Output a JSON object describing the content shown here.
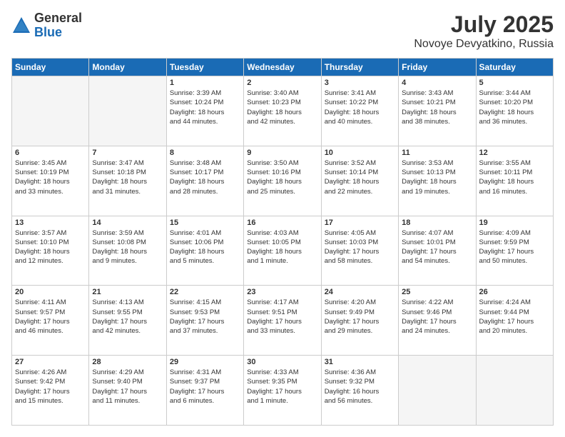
{
  "logo": {
    "general": "General",
    "blue": "Blue"
  },
  "header": {
    "month": "July 2025",
    "location": "Novoye Devyatkino, Russia"
  },
  "weekdays": [
    "Sunday",
    "Monday",
    "Tuesday",
    "Wednesday",
    "Thursday",
    "Friday",
    "Saturday"
  ],
  "weeks": [
    [
      {
        "day": "",
        "info": ""
      },
      {
        "day": "",
        "info": ""
      },
      {
        "day": "1",
        "info": "Sunrise: 3:39 AM\nSunset: 10:24 PM\nDaylight: 18 hours\nand 44 minutes."
      },
      {
        "day": "2",
        "info": "Sunrise: 3:40 AM\nSunset: 10:23 PM\nDaylight: 18 hours\nand 42 minutes."
      },
      {
        "day": "3",
        "info": "Sunrise: 3:41 AM\nSunset: 10:22 PM\nDaylight: 18 hours\nand 40 minutes."
      },
      {
        "day": "4",
        "info": "Sunrise: 3:43 AM\nSunset: 10:21 PM\nDaylight: 18 hours\nand 38 minutes."
      },
      {
        "day": "5",
        "info": "Sunrise: 3:44 AM\nSunset: 10:20 PM\nDaylight: 18 hours\nand 36 minutes."
      }
    ],
    [
      {
        "day": "6",
        "info": "Sunrise: 3:45 AM\nSunset: 10:19 PM\nDaylight: 18 hours\nand 33 minutes."
      },
      {
        "day": "7",
        "info": "Sunrise: 3:47 AM\nSunset: 10:18 PM\nDaylight: 18 hours\nand 31 minutes."
      },
      {
        "day": "8",
        "info": "Sunrise: 3:48 AM\nSunset: 10:17 PM\nDaylight: 18 hours\nand 28 minutes."
      },
      {
        "day": "9",
        "info": "Sunrise: 3:50 AM\nSunset: 10:16 PM\nDaylight: 18 hours\nand 25 minutes."
      },
      {
        "day": "10",
        "info": "Sunrise: 3:52 AM\nSunset: 10:14 PM\nDaylight: 18 hours\nand 22 minutes."
      },
      {
        "day": "11",
        "info": "Sunrise: 3:53 AM\nSunset: 10:13 PM\nDaylight: 18 hours\nand 19 minutes."
      },
      {
        "day": "12",
        "info": "Sunrise: 3:55 AM\nSunset: 10:11 PM\nDaylight: 18 hours\nand 16 minutes."
      }
    ],
    [
      {
        "day": "13",
        "info": "Sunrise: 3:57 AM\nSunset: 10:10 PM\nDaylight: 18 hours\nand 12 minutes."
      },
      {
        "day": "14",
        "info": "Sunrise: 3:59 AM\nSunset: 10:08 PM\nDaylight: 18 hours\nand 9 minutes."
      },
      {
        "day": "15",
        "info": "Sunrise: 4:01 AM\nSunset: 10:06 PM\nDaylight: 18 hours\nand 5 minutes."
      },
      {
        "day": "16",
        "info": "Sunrise: 4:03 AM\nSunset: 10:05 PM\nDaylight: 18 hours\nand 1 minute."
      },
      {
        "day": "17",
        "info": "Sunrise: 4:05 AM\nSunset: 10:03 PM\nDaylight: 17 hours\nand 58 minutes."
      },
      {
        "day": "18",
        "info": "Sunrise: 4:07 AM\nSunset: 10:01 PM\nDaylight: 17 hours\nand 54 minutes."
      },
      {
        "day": "19",
        "info": "Sunrise: 4:09 AM\nSunset: 9:59 PM\nDaylight: 17 hours\nand 50 minutes."
      }
    ],
    [
      {
        "day": "20",
        "info": "Sunrise: 4:11 AM\nSunset: 9:57 PM\nDaylight: 17 hours\nand 46 minutes."
      },
      {
        "day": "21",
        "info": "Sunrise: 4:13 AM\nSunset: 9:55 PM\nDaylight: 17 hours\nand 42 minutes."
      },
      {
        "day": "22",
        "info": "Sunrise: 4:15 AM\nSunset: 9:53 PM\nDaylight: 17 hours\nand 37 minutes."
      },
      {
        "day": "23",
        "info": "Sunrise: 4:17 AM\nSunset: 9:51 PM\nDaylight: 17 hours\nand 33 minutes."
      },
      {
        "day": "24",
        "info": "Sunrise: 4:20 AM\nSunset: 9:49 PM\nDaylight: 17 hours\nand 29 minutes."
      },
      {
        "day": "25",
        "info": "Sunrise: 4:22 AM\nSunset: 9:46 PM\nDaylight: 17 hours\nand 24 minutes."
      },
      {
        "day": "26",
        "info": "Sunrise: 4:24 AM\nSunset: 9:44 PM\nDaylight: 17 hours\nand 20 minutes."
      }
    ],
    [
      {
        "day": "27",
        "info": "Sunrise: 4:26 AM\nSunset: 9:42 PM\nDaylight: 17 hours\nand 15 minutes."
      },
      {
        "day": "28",
        "info": "Sunrise: 4:29 AM\nSunset: 9:40 PM\nDaylight: 17 hours\nand 11 minutes."
      },
      {
        "day": "29",
        "info": "Sunrise: 4:31 AM\nSunset: 9:37 PM\nDaylight: 17 hours\nand 6 minutes."
      },
      {
        "day": "30",
        "info": "Sunrise: 4:33 AM\nSunset: 9:35 PM\nDaylight: 17 hours\nand 1 minute."
      },
      {
        "day": "31",
        "info": "Sunrise: 4:36 AM\nSunset: 9:32 PM\nDaylight: 16 hours\nand 56 minutes."
      },
      {
        "day": "",
        "info": ""
      },
      {
        "day": "",
        "info": ""
      }
    ]
  ]
}
